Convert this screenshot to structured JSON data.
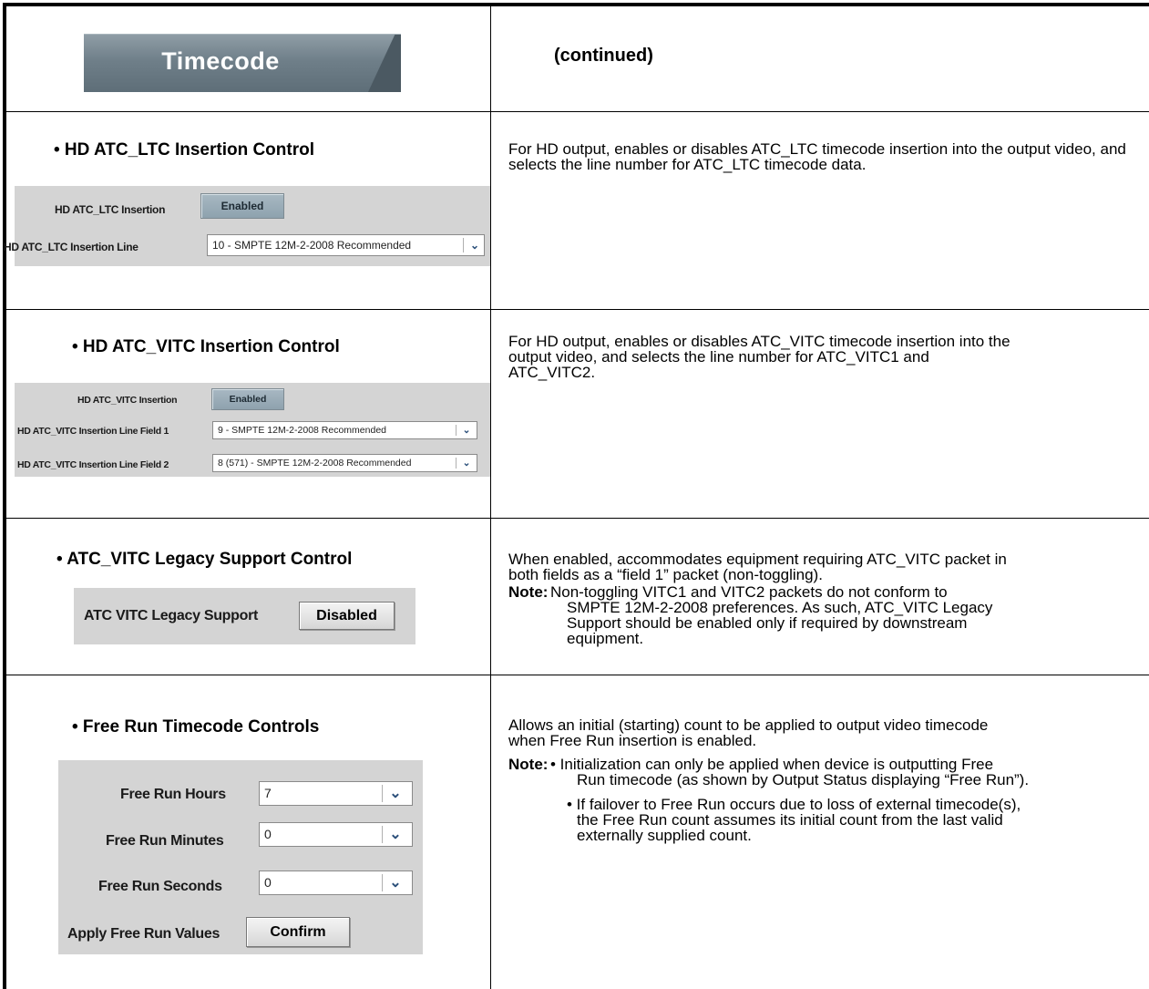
{
  "header": {
    "tab_title": "Timecode",
    "continued": "(continued)"
  },
  "sections": [
    {
      "title": "• HD ATC_LTC Insertion Control",
      "description": "For HD output, enables or disables ATC_LTC timecode insertion into the output video, and selects the line number for ATC_LTC timecode data.",
      "insertion_label": "HD ATC_LTC Insertion",
      "insertion_value": "Enabled",
      "line_label": "HD ATC_LTC Insertion Line",
      "line_value": "10 - SMPTE 12M-2-2008 Recommended"
    },
    {
      "title": "• HD ATC_VITC Insertion Control",
      "description_l1": "For HD output, enables or disables ATC_VITC timecode insertion into the",
      "description_l2": "output video, and selects the line number for ATC_VITC1 and",
      "description_l3": "ATC_VITC2.",
      "insertion_label": "HD ATC_VITC Insertion",
      "insertion_value": "Enabled",
      "field1_label": "HD ATC_VITC Insertion Line Field 1",
      "field1_value": "9 - SMPTE 12M-2-2008 Recommended",
      "field2_label": "HD ATC_VITC Insertion Line Field 2",
      "field2_value": "8 (571) - SMPTE 12M-2-2008 Recommended"
    },
    {
      "title": "• ATC_VITC Legacy Support Control",
      "description_l1": "When enabled, accommodates equipment requiring ATC_VITC packet in",
      "description_l2": "both fields as a “field 1” packet (non-toggling).",
      "note_label": "Note:",
      "note_l1": "Non-toggling VITC1 and VITC2 packets do not conform to",
      "note_l2": "SMPTE 12M-2-2008 preferences. As such, ATC_VITC Legacy",
      "note_l3": "Support should be enabled only if required by downstream",
      "note_l4": "equipment.",
      "legacy_label": "ATC VITC Legacy Support",
      "legacy_value": "Disabled"
    },
    {
      "title": "• Free Run Timecode Controls",
      "description_l1": "Allows an initial (starting) count to be applied to output video timecode",
      "description_l2": "when Free Run insertion is enabled.",
      "note_label": "Note:",
      "note_b1_l1": "• Initialization can only be applied when device is outputting Free",
      "note_b1_l2": "Run timecode (as shown by Output Status displaying “Free Run”).",
      "note_b2_l1": "• If failover to Free Run occurs due to loss of external timecode(s),",
      "note_b2_l2": "the Free Run count assumes its initial count from the last valid",
      "note_b2_l3": "externally supplied count.",
      "hours_label": "Free Run Hours",
      "hours_value": "7",
      "minutes_label": "Free Run Minutes",
      "minutes_value": "0",
      "seconds_label": "Free Run Seconds",
      "seconds_value": "0",
      "apply_label": "Apply Free Run Values",
      "apply_button": "Confirm"
    }
  ],
  "icons": {
    "dropdown": "chevron-down-icon"
  }
}
